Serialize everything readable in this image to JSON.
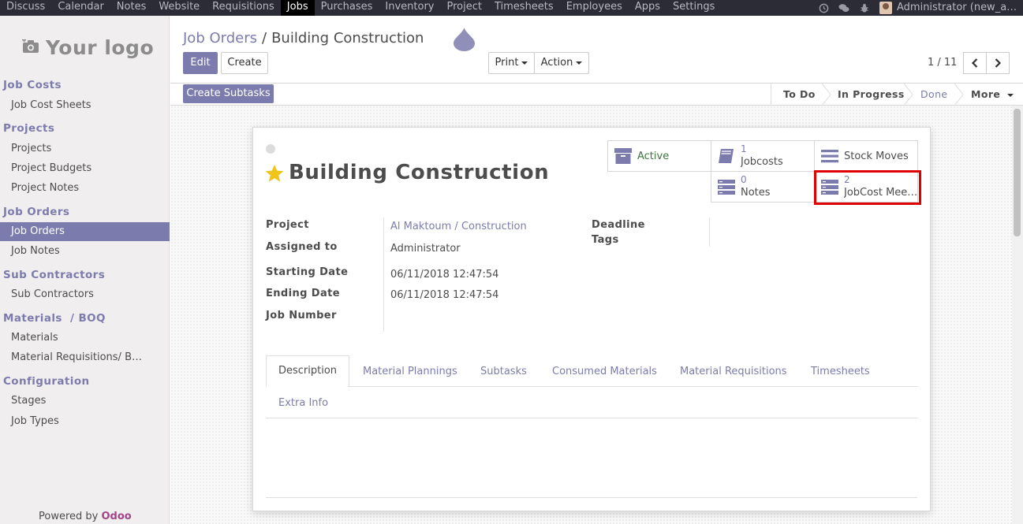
{
  "topbar": {
    "menu": [
      "Discuss",
      "Calendar",
      "Notes",
      "Website",
      "Requisitions",
      "Jobs",
      "Purchases",
      "Inventory",
      "Project",
      "Timesheets",
      "Employees",
      "Apps",
      "Settings"
    ],
    "active_menu": "Jobs",
    "user": "Administrator (new_a…"
  },
  "sidebar": {
    "logo_text": "Your logo",
    "sections": [
      {
        "title": "Job Costs",
        "items": [
          "Job Cost Sheets"
        ]
      },
      {
        "title": "Projects",
        "items": [
          "Projects",
          "Project Budgets",
          "Project Notes"
        ]
      },
      {
        "title": "Job Orders",
        "items": [
          "Job Orders",
          "Job Notes"
        ]
      },
      {
        "title": "Sub Contractors",
        "items": [
          "Sub Contractors"
        ]
      },
      {
        "title": "Materials  / BOQ",
        "items": [
          "Materials",
          "Material Requisitions/ B…"
        ]
      },
      {
        "title": "Configuration",
        "items": [
          "Stages",
          "Job Types"
        ]
      }
    ],
    "active_item": "Job Orders",
    "powered_prefix": "Powered by ",
    "powered_brand": "Odoo"
  },
  "control_panel": {
    "breadcrumb_parent": "Job Orders",
    "breadcrumb_sep": "/",
    "breadcrumb_current": "Building Construction",
    "edit_label": "Edit",
    "create_label": "Create",
    "print_label": "Print",
    "action_label": "Action",
    "pager": "1 / 11"
  },
  "statusbar": {
    "create_subtasks": "Create Subtasks",
    "stages": [
      "To Do",
      "In Progress",
      "Done"
    ],
    "current_stage": "Done",
    "more_label": "More"
  },
  "form": {
    "title": "Building Construction",
    "starred": true,
    "smart_buttons": {
      "active": {
        "label": "Active",
        "icon": "archive-icon"
      },
      "jobcosts": {
        "count": "1",
        "label": "Jobcosts",
        "icon": "book-icon"
      },
      "stock_moves": {
        "label": "Stock Moves",
        "icon": "list-icon"
      },
      "notes": {
        "count": "0",
        "label": "Notes",
        "icon": "server-icon"
      },
      "jobcost_meetings": {
        "count": "2",
        "label": "JobCost Mee…",
        "icon": "server-icon"
      }
    },
    "fields": {
      "project_label": "Project",
      "project_value": "Al Maktoum / Construction",
      "assigned_label": "Assigned to",
      "assigned_value": "Administrator",
      "start_label": "Starting Date",
      "start_value": "06/11/2018 12:47:54",
      "end_label": "Ending Date",
      "end_value": "06/11/2018 12:47:54",
      "job_number_label": "Job Number",
      "deadline_label": "Deadline",
      "tags_label": "Tags"
    },
    "tabs": [
      "Description",
      "Material Plannings",
      "Subtasks",
      "Consumed Materials",
      "Material Requisitions",
      "Timesheets",
      "Extra Info"
    ],
    "active_tab": "Description"
  },
  "colors": {
    "accent": "#7c7bad",
    "topbar": "#2c2c36",
    "highlight": "#e00000",
    "active_status": "#3c763d",
    "star": "#f0c419"
  }
}
